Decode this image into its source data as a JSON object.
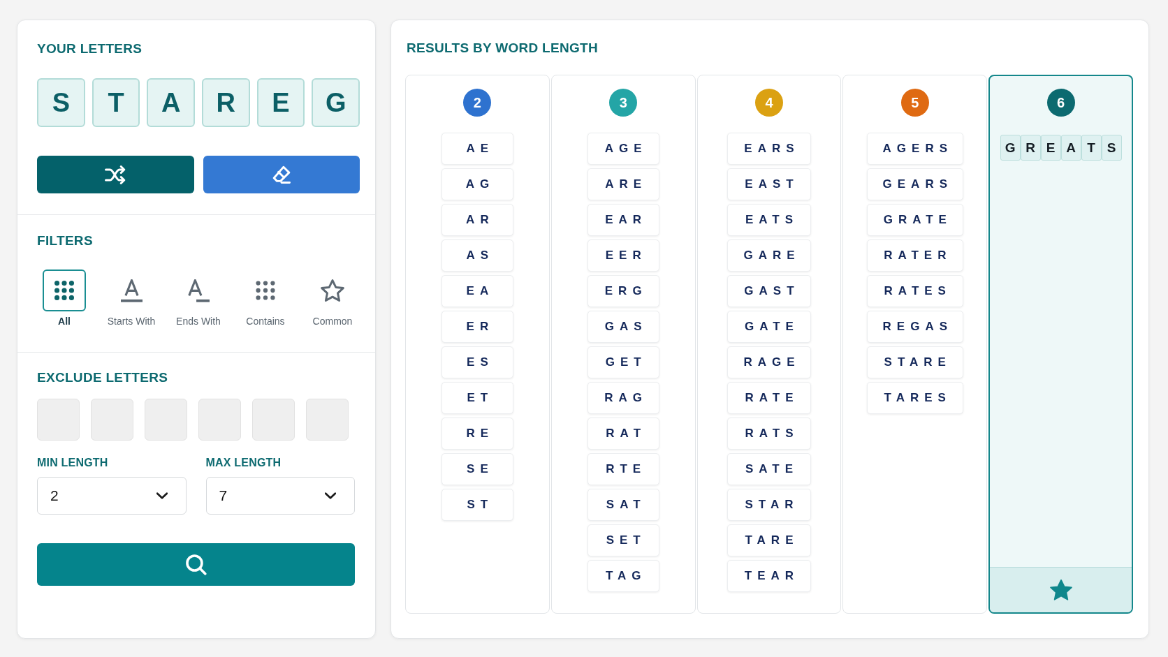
{
  "your_letters": {
    "title": "YOUR LETTERS",
    "letters": [
      "S",
      "T",
      "A",
      "R",
      "E",
      "G"
    ]
  },
  "filters": {
    "title": "FILTERS",
    "items": [
      {
        "kind": "all",
        "label": "All",
        "selected": true
      },
      {
        "kind": "prefix",
        "label": "Starts With",
        "selected": false
      },
      {
        "kind": "suffix",
        "label": "Ends With",
        "selected": false
      },
      {
        "kind": "contains",
        "label": "Contains",
        "selected": false
      },
      {
        "kind": "common",
        "label": "Common",
        "selected": false
      }
    ]
  },
  "exclude_letters": {
    "title": "EXCLUDE LETTERS"
  },
  "min_length": {
    "label": "MIN LENGTH",
    "value": "2"
  },
  "max_length": {
    "label": "MAX LENGTH",
    "value": "7"
  },
  "results": {
    "title": "RESULTS BY WORD LENGTH",
    "columns": [
      {
        "length": "2",
        "color": "#2e72cf",
        "selected": false,
        "kind": "chips",
        "words": [
          "AE",
          "AG",
          "AR",
          "AS",
          "EA",
          "ER",
          "ES",
          "ET",
          "RE",
          "SE",
          "ST"
        ]
      },
      {
        "length": "3",
        "color": "#24a5a6",
        "selected": false,
        "kind": "chips",
        "words": [
          "AGE",
          "ARE",
          "EAR",
          "EER",
          "ERG",
          "GAS",
          "GET",
          "RAG",
          "RAT",
          "RTE",
          "SAT",
          "SET",
          "TAG"
        ]
      },
      {
        "length": "4",
        "color": "#dba112",
        "selected": false,
        "kind": "chips",
        "words": [
          "EARS",
          "EAST",
          "EATS",
          "GARE",
          "GAST",
          "GATE",
          "RAGE",
          "RATE",
          "RATS",
          "SATE",
          "STAR",
          "TARE",
          "TEAR"
        ]
      },
      {
        "length": "5",
        "color": "#df6a12",
        "selected": false,
        "kind": "chips",
        "words": [
          "AGERS",
          "GEARS",
          "GRATE",
          "RATER",
          "RATES",
          "REGAS",
          "STARE",
          "TARES"
        ]
      },
      {
        "length": "6",
        "color": "#0c6a70",
        "selected": true,
        "kind": "tiles",
        "words": [
          [
            "G",
            "R",
            "E",
            "A",
            "T",
            "S"
          ]
        ]
      }
    ]
  }
}
